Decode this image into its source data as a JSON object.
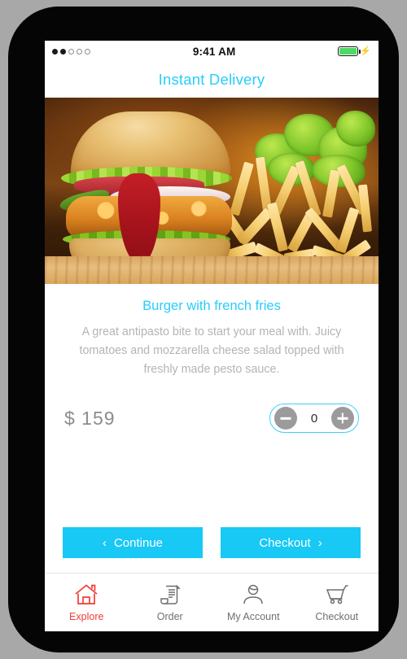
{
  "status_bar": {
    "signal_dots_filled": 2,
    "signal_dots_total": 5,
    "time": "9:41 AM",
    "battery_icon": "battery-icon",
    "charging_icon": "lightning-bolt-icon"
  },
  "header": {
    "title": "Instant Delivery"
  },
  "hero": {
    "image_alt": "Burger with french fries photo"
  },
  "product": {
    "name": "Burger with french fries",
    "description": "A great antipasto bite to start your meal with. Juicy tomatoes and mozzarella cheese salad topped with freshly made pesto sauce.",
    "price": "$ 159",
    "quantity": "0",
    "decrease_label": "−",
    "increase_label": "+"
  },
  "actions": {
    "continue_label": "Continue",
    "continue_chevron": "‹",
    "checkout_label": "Checkout",
    "checkout_chevron": "›"
  },
  "tabs": [
    {
      "label": "Explore",
      "icon": "home-icon",
      "active": true
    },
    {
      "label": "Order",
      "icon": "document-icon",
      "active": false
    },
    {
      "label": "My Account",
      "icon": "person-icon",
      "active": false
    },
    {
      "label": "Checkout",
      "icon": "cart-icon",
      "active": false
    }
  ],
  "colors": {
    "accent_cyan": "#18c8f5",
    "title_cyan": "#29cdfb",
    "active_tab_red": "#ef3e36",
    "muted_gray": "#b4b4b4",
    "price_gray": "#8d8d8d",
    "stepper_button_gray": "#9b9b9b",
    "battery_green": "#4cd964",
    "frame_black": "#050505",
    "page_background": "#a8a8a8"
  }
}
